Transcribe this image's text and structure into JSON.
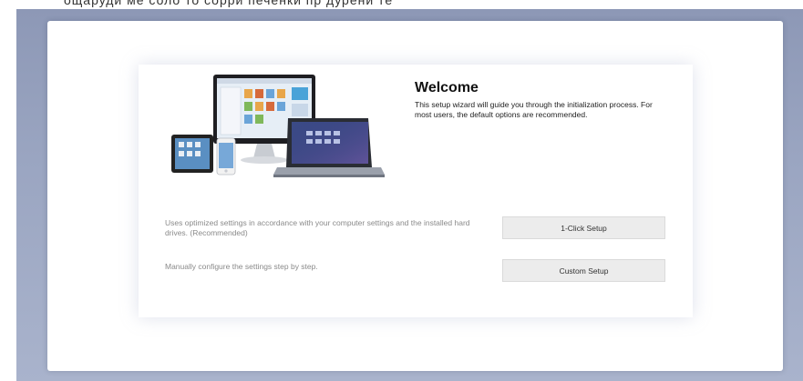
{
  "header": {
    "ghost_text": "ощаруди ме соло то сорри печенки пр дурени те"
  },
  "welcome": {
    "title": "Welcome",
    "description": "This setup wizard will guide you through the initialization process. For most users, the default options are recommended."
  },
  "options": [
    {
      "description": "Uses optimized settings in accordance with your computer settings and the installed hard drives. (Recommended)",
      "button_label": "1-Click Setup"
    },
    {
      "description": "Manually configure the settings step by step.",
      "button_label": "Custom Setup"
    }
  ],
  "icons": {
    "illustration": "devices-illustration"
  },
  "colors": {
    "background": "#9aa5c1",
    "button": "#ececec"
  }
}
